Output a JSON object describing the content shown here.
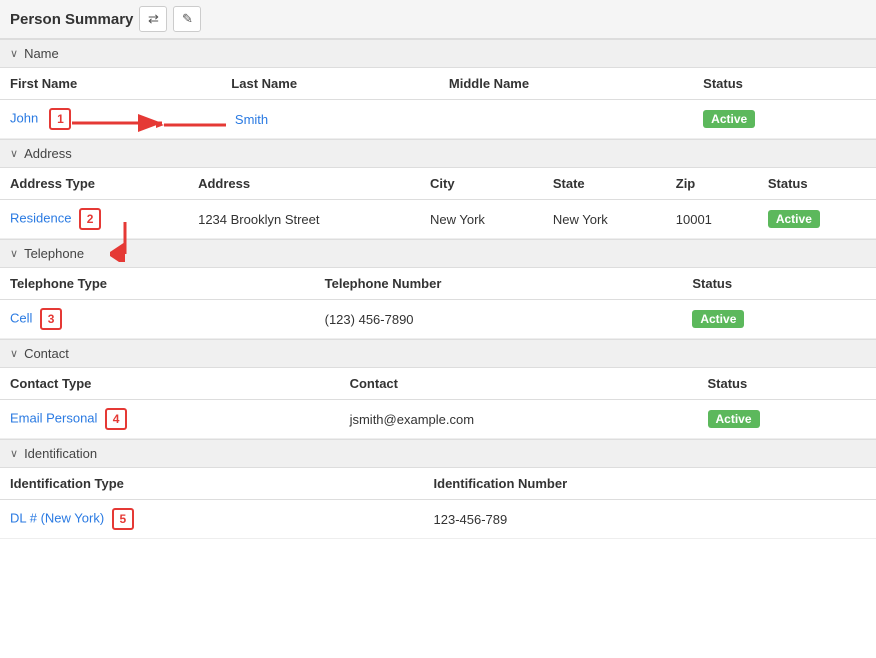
{
  "header": {
    "title": "Person Summary",
    "btn1_icon": "⇄",
    "btn2_icon": "✎"
  },
  "sections": {
    "name": {
      "label": "Name",
      "columns": [
        "First Name",
        "Last Name",
        "Middle Name",
        "Status"
      ],
      "rows": [
        {
          "first_name": "John",
          "last_name": "Smith",
          "middle_name": "",
          "status": "Active"
        }
      ]
    },
    "address": {
      "label": "Address",
      "columns": [
        "Address Type",
        "Address",
        "City",
        "State",
        "Zip",
        "Status"
      ],
      "rows": [
        {
          "type": "Residence",
          "address": "1234 Brooklyn Street",
          "city": "New York",
          "state": "New York",
          "zip": "10001",
          "status": "Active"
        }
      ]
    },
    "telephone": {
      "label": "Telephone",
      "columns": [
        "Telephone Type",
        "Telephone Number",
        "Status"
      ],
      "rows": [
        {
          "type": "Cell",
          "number": "(123) 456-7890",
          "status": "Active"
        }
      ]
    },
    "contact": {
      "label": "Contact",
      "columns": [
        "Contact Type",
        "Contact",
        "Status"
      ],
      "rows": [
        {
          "type": "Email Personal",
          "contact": "jsmith@example.com",
          "status": "Active"
        }
      ]
    },
    "identification": {
      "label": "Identification",
      "columns": [
        "Identification Type",
        "Identification Number"
      ],
      "rows": [
        {
          "type": "DL # (New York)",
          "number": "123-456-789"
        }
      ]
    }
  },
  "annotations": {
    "1": "1",
    "2": "2",
    "3": "3",
    "4": "4",
    "5": "5"
  }
}
